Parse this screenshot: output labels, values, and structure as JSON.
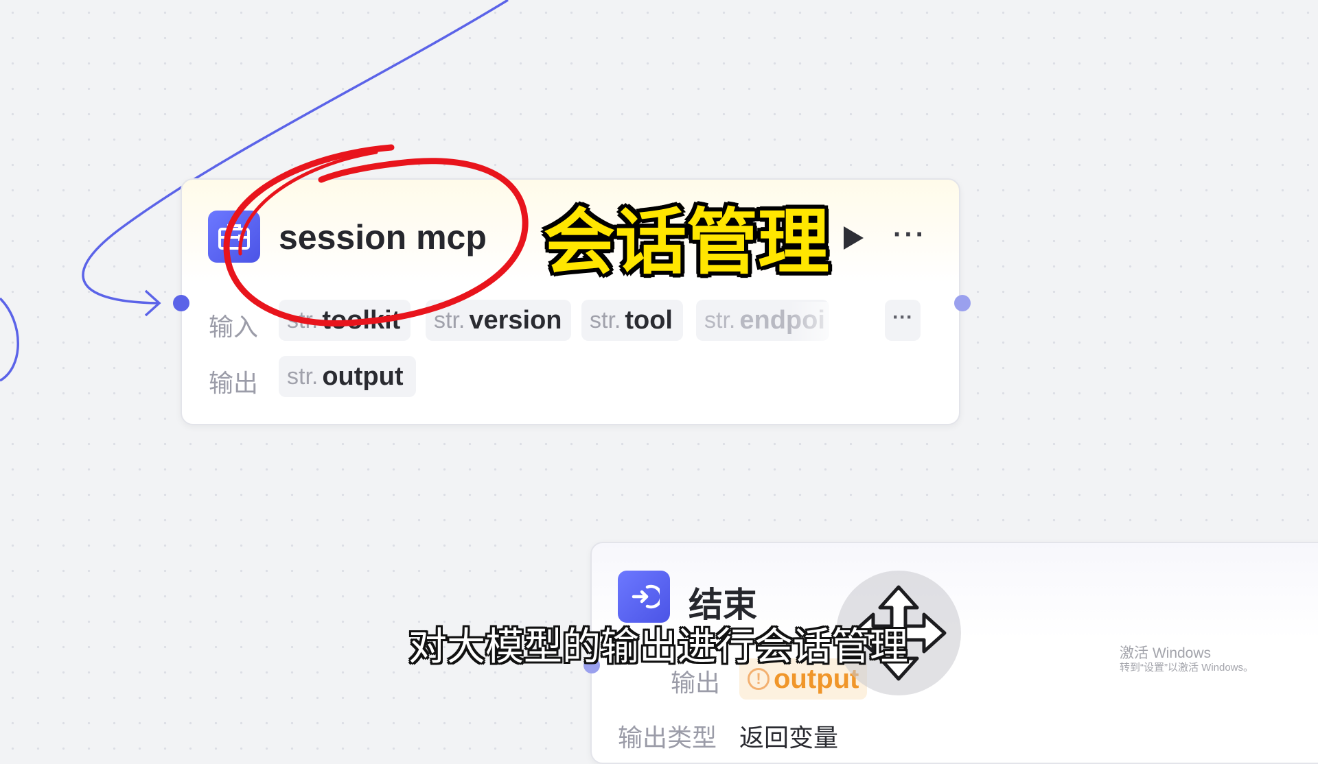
{
  "overlay": {
    "title": "会话管理",
    "subtitle": "对大模型的输出进行会话管理"
  },
  "session_node": {
    "title": "session mcp",
    "icon": "toolbox-icon",
    "run_icon": "play-icon",
    "more_icon": "more-dots-icon",
    "more_label": "···",
    "inputs_label": "输入",
    "outputs_label": "输出",
    "inputs": [
      {
        "type": "str.",
        "name": "toolkit"
      },
      {
        "type": "str.",
        "name": "version"
      },
      {
        "type": "str.",
        "name": "tool"
      },
      {
        "type": "str.",
        "name": "endpoi"
      }
    ],
    "more_inputs_label": "···",
    "outputs": [
      {
        "type": "str.",
        "name": "output"
      }
    ]
  },
  "end_node": {
    "title": "结束",
    "icon": "exit-icon",
    "output_label": "输出",
    "output_value": "output",
    "output_warning_icon": "warning-circle-icon",
    "output_type_label": "输出类型",
    "output_type_value": "返回变量"
  },
  "watermark": {
    "line1": "激活 Windows",
    "line2": "转到“设置”以激活 Windows。"
  },
  "colors": {
    "accent": "#5b63e8",
    "annotation_red": "#e8141c",
    "overlay_yellow": "#ffe600",
    "warning_orange": "#f0962a"
  }
}
